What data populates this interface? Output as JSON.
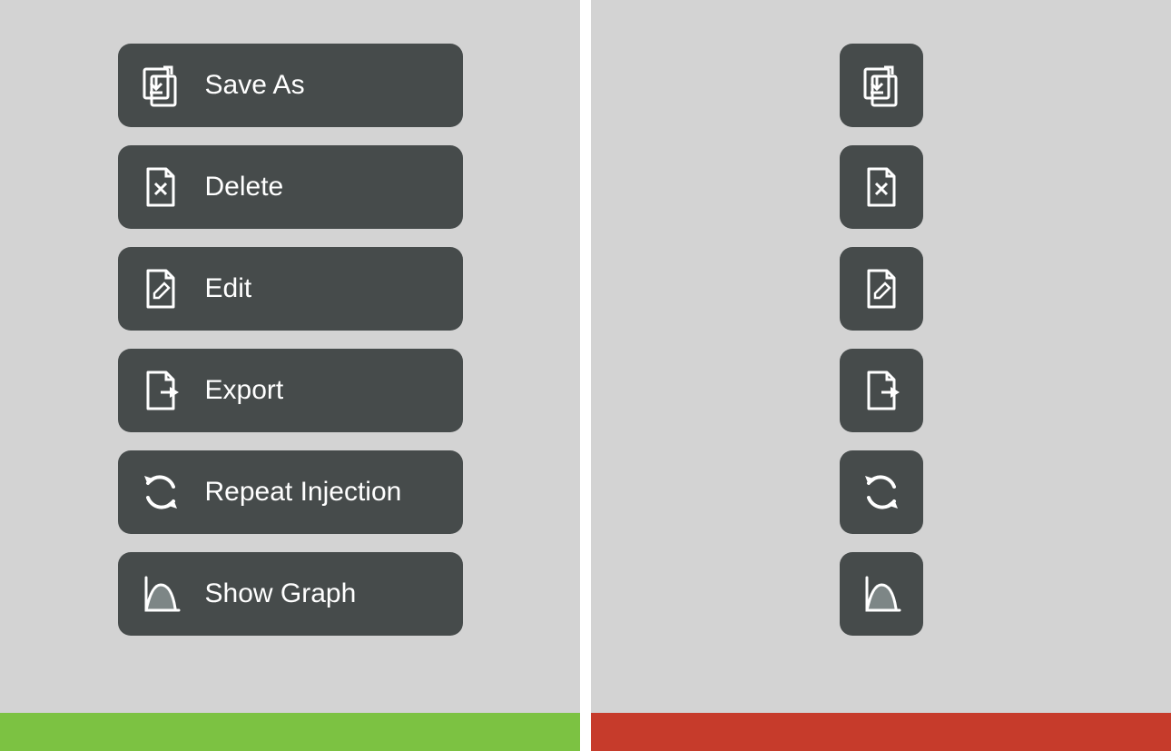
{
  "buttons": [
    {
      "id": "save-as",
      "label": "Save As",
      "icon": "save-as-icon"
    },
    {
      "id": "delete",
      "label": "Delete",
      "icon": "delete-icon"
    },
    {
      "id": "edit",
      "label": "Edit",
      "icon": "edit-icon"
    },
    {
      "id": "export",
      "label": "Export",
      "icon": "export-icon"
    },
    {
      "id": "repeat-injection",
      "label": "Repeat Injection",
      "icon": "repeat-icon"
    },
    {
      "id": "show-graph",
      "label": "Show Graph",
      "icon": "graph-icon"
    }
  ],
  "colors": {
    "button_bg": "#464b4b",
    "button_fg": "#ffffff",
    "panel_bg": "#d3d3d3",
    "footer_left": "#7cc242",
    "footer_right": "#c63b2b"
  }
}
